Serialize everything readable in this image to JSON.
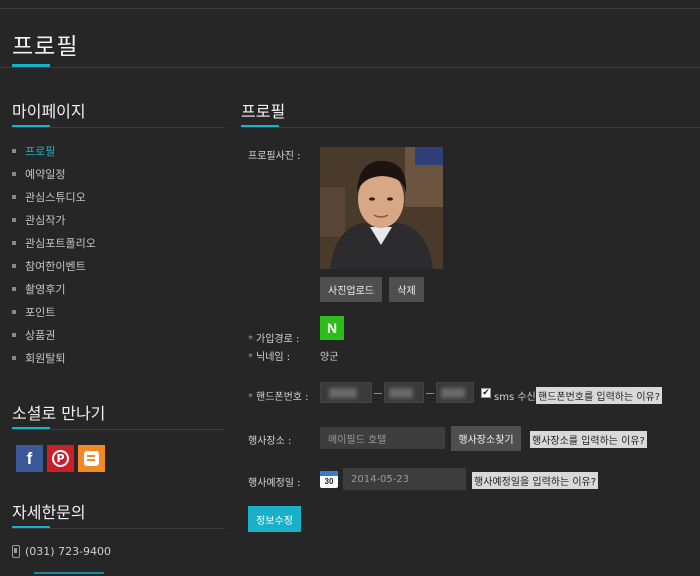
{
  "page": {
    "title": "프로필"
  },
  "sidebar": {
    "mypage_heading": "마이페이지",
    "menu": [
      {
        "label": "프로필",
        "active": true
      },
      {
        "label": "예약일정",
        "active": false
      },
      {
        "label": "관심스튜디오",
        "active": false
      },
      {
        "label": "관심작가",
        "active": false
      },
      {
        "label": "관심포트폴리오",
        "active": false
      },
      {
        "label": "참여한이벤트",
        "active": false
      },
      {
        "label": "촬영후기",
        "active": false
      },
      {
        "label": "포인트",
        "active": false
      },
      {
        "label": "상품권",
        "active": false
      },
      {
        "label": "회원탈퇴",
        "active": false
      }
    ],
    "social_heading": "소셜로 만나기",
    "social_icons": [
      "facebook-icon",
      "pinterest-icon",
      "blogger-icon"
    ],
    "contact_heading": "자세한문의",
    "contact_phone": "(031) 723-9400"
  },
  "main": {
    "heading": "프로필",
    "photo_label": "프로필사진 :",
    "upload_button": "사진업로드",
    "delete_button": "삭제",
    "join_route_label": "가입경로 :",
    "join_route_icon": "N",
    "nickname_label": "닉네임 :",
    "nickname_value": "양군",
    "phone_label": "핸드폰번호 :",
    "sms_label": "sms 수신",
    "sms_checked": true,
    "phone_hint": "핸드폰번호를 입력하는 이유?",
    "venue_label": "행사장소 :",
    "venue_placeholder": "메이필드 호텔",
    "venue_button": "행사장소찾기",
    "venue_hint": "행사장소를 입력하는 이유?",
    "date_label": "행사예정일 :",
    "calendar_day": "30",
    "date_value": "2014-05-23",
    "date_hint": "행사예정일을 입력하는 이유?",
    "submit_button": "정보수정"
  },
  "colors": {
    "accent": "#19b1c8",
    "background": "#262626",
    "naver": "#2dbd19"
  }
}
